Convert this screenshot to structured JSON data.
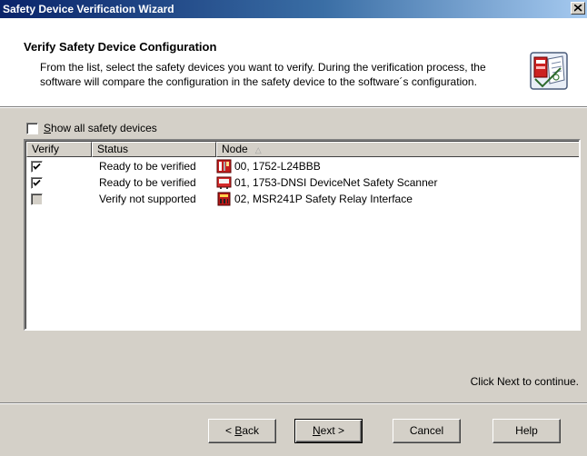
{
  "window": {
    "title": "Safety Device Verification Wizard"
  },
  "header": {
    "title": "Verify Safety Device Configuration",
    "description": "From the list, select the safety devices you want to verify. During the verification process, the software will compare the configuration in the safety device to the software´s configuration."
  },
  "show_all": {
    "label_prefix": "",
    "label_mnemonic": "S",
    "label_rest": "how all safety devices",
    "checked": false
  },
  "list": {
    "columns": {
      "verify": "Verify",
      "status": "Status",
      "node": "Node"
    },
    "sort_indicator": "△",
    "rows": [
      {
        "checked": true,
        "enabled": true,
        "status": "Ready to be verified",
        "node": "00, 1752-L24BBB",
        "icon": "controller-icon"
      },
      {
        "checked": true,
        "enabled": true,
        "status": "Ready to be verified",
        "node": "01, 1753-DNSI DeviceNet Safety Scanner",
        "icon": "scanner-icon"
      },
      {
        "checked": false,
        "enabled": false,
        "status": "Verify not supported",
        "node": "02, MSR241P Safety Relay Interface",
        "icon": "relay-icon"
      }
    ]
  },
  "footer": {
    "note": "Click Next to continue."
  },
  "buttons": {
    "back_prefix": "< ",
    "back_mnemonic": "B",
    "back_rest": "ack",
    "next_mnemonic": "N",
    "next_rest": "ext >",
    "cancel": "Cancel",
    "help": "Help"
  },
  "colors": {
    "titlebar_start": "#0a246a",
    "titlebar_end": "#a6caf0",
    "face": "#d4d0c8"
  }
}
